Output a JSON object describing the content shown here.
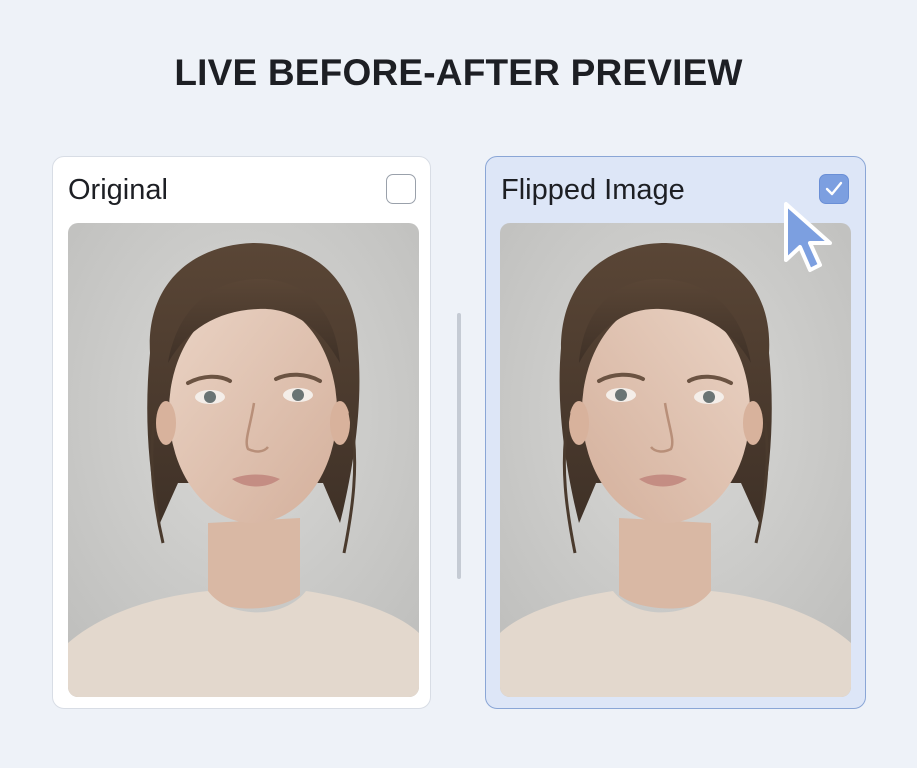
{
  "page": {
    "title": "LIVE BEFORE-AFTER PREVIEW"
  },
  "cards": [
    {
      "label": "Original",
      "checked": false
    },
    {
      "label": "Flipped Image",
      "checked": true
    }
  ],
  "colors": {
    "accent": "#7c9fe0",
    "selected_card_bg": "#dde6f7",
    "selected_card_border": "#8aa6d6",
    "page_bg": "#eef2f8"
  },
  "icons": {
    "checkmark": "check-icon",
    "cursor": "mouse-pointer-icon"
  }
}
